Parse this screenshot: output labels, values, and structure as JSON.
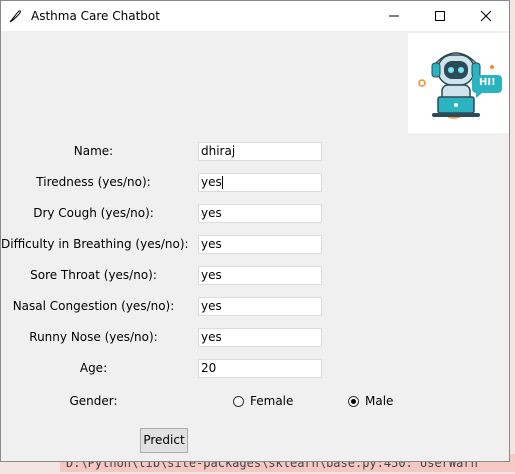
{
  "window": {
    "title": "Asthma Care Chatbot",
    "icon": "feather-icon",
    "controls": [
      "minimize-icon",
      "maximize-icon",
      "close-icon"
    ]
  },
  "robot_image": {
    "badge_text": "HI!"
  },
  "form": {
    "fields": [
      {
        "label": "Name:",
        "value": "dhiraj"
      },
      {
        "label": "Tiredness (yes/no):",
        "value": "yes"
      },
      {
        "label": "Dry Cough (yes/no):",
        "value": "yes"
      },
      {
        "label": "Difficulty in Breathing (yes/no):",
        "value": "yes"
      },
      {
        "label": "Sore Throat (yes/no):",
        "value": "yes"
      },
      {
        "label": "Nasal Congestion (yes/no):",
        "value": "yes"
      },
      {
        "label": "Runny Nose (yes/no):",
        "value": "yes"
      },
      {
        "label": "Age:",
        "value": "20"
      }
    ],
    "gender": {
      "label": "Gender:",
      "options": [
        "Female",
        "Male"
      ],
      "selected": "Male"
    },
    "predict_label": "Predict"
  },
  "background": {
    "terminal_text": "D:\\Python\\lib\\site-packages\\sklearn\\base.py:450: UserWarn"
  },
  "colors": {
    "robot_accent": "#2bb3c0",
    "robot_orange": "#f58a2d"
  }
}
